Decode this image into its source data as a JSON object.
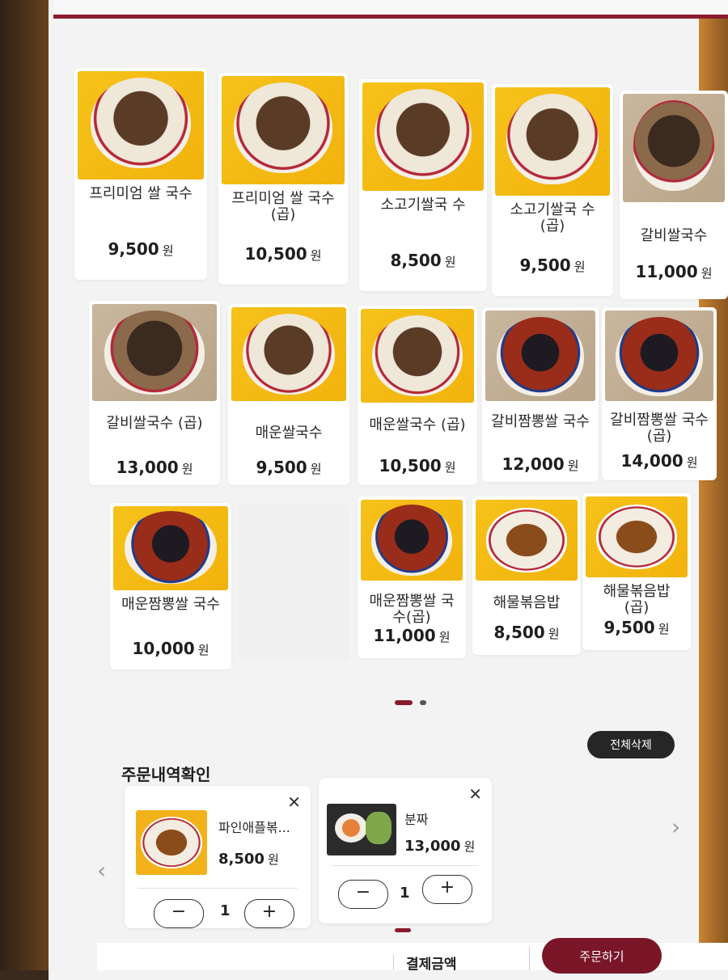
{
  "menu": {
    "items": [
      {
        "name": "프리미엄 쌀 국수",
        "price": "9,500",
        "bg": "yellow",
        "dish": "beef"
      },
      {
        "name": "프리미엄 쌀 국수(곱)",
        "price": "10,500",
        "bg": "yellow",
        "dish": "beef"
      },
      {
        "name": "소고기쌀국 수",
        "price": "8,500",
        "bg": "yellow",
        "dish": "beef"
      },
      {
        "name": "소고기쌀국 수(곱)",
        "price": "9,500",
        "bg": "yellow",
        "dish": "beef"
      },
      {
        "name": "갈비쌀국수",
        "price": "11,000",
        "bg": "beige",
        "dish": "broth"
      },
      {
        "name": "갈비쌀국수 (곱)",
        "price": "13,000",
        "bg": "beige",
        "dish": "broth"
      },
      {
        "name": "매운쌀국수",
        "price": "9,500",
        "bg": "yellow",
        "dish": "beef"
      },
      {
        "name": "매운쌀국수 (곱)",
        "price": "10,500",
        "bg": "yellow",
        "dish": "beef"
      },
      {
        "name": "갈비짬뽕쌀 국수",
        "price": "12,000",
        "bg": "beige",
        "dish": "spicy"
      },
      {
        "name": "갈비짬뽕쌀 국수(곱)",
        "price": "14,000",
        "bg": "beige",
        "dish": "spicy"
      },
      {
        "name": "매운짬뽕쌀 국수",
        "price": "10,000",
        "bg": "yellow",
        "dish": "spicy"
      },
      {
        "name": "매운짬뽕쌀 국수(곱)",
        "price": "11,000",
        "bg": "yellow",
        "dish": "spicy"
      },
      {
        "name": "해물볶음밥",
        "price": "8,500",
        "bg": "yellow",
        "dish": "rice"
      },
      {
        "name": "해물볶음밥 (곱)",
        "price": "9,500",
        "bg": "yellow",
        "dish": "rice"
      }
    ],
    "currency": "원"
  },
  "pagination": {
    "active_page": 1,
    "total_pages": 2
  },
  "order": {
    "title": "주문내역확인",
    "clear_all": "전체삭제",
    "close_symbol": "✕",
    "items": [
      {
        "name": "파인애플볶...",
        "price": "8,500",
        "currency": "원",
        "qty": "1",
        "minus": "−",
        "plus": "+"
      },
      {
        "name": "분짜",
        "price": "13,000",
        "currency": "원",
        "qty": "1",
        "minus": "−",
        "plus": "+"
      }
    ],
    "prev_arrow": "‹",
    "next_arrow": "›"
  },
  "footer": {
    "payment_label": "결제금액",
    "order_button": "주문하기"
  },
  "colors": {
    "accent": "#8b1a2e",
    "order_button": "#7a1628",
    "card_bg_yellow": "#f6c21a"
  }
}
